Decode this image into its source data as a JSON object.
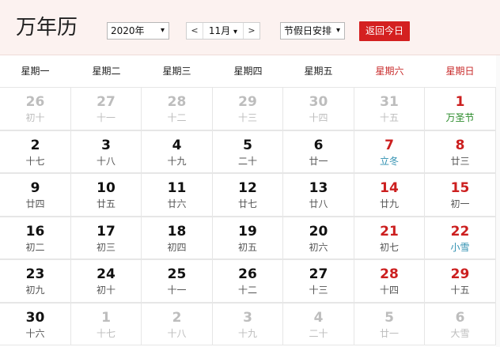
{
  "header": {
    "title": "万年历",
    "year_select": "2020年",
    "month_value": "11月",
    "prev": "<",
    "next": ">",
    "holiday_select": "节假日安排",
    "today_button": "返回今日",
    "arrow": "▾"
  },
  "weekdays": [
    "星期一",
    "星期二",
    "星期三",
    "星期四",
    "星期五",
    "星期六",
    "星期日"
  ],
  "weeks": [
    [
      {
        "day": "26",
        "lunar": "初十",
        "other": true
      },
      {
        "day": "27",
        "lunar": "十一",
        "other": true
      },
      {
        "day": "28",
        "lunar": "十二",
        "other": true
      },
      {
        "day": "29",
        "lunar": "十三",
        "other": true
      },
      {
        "day": "30",
        "lunar": "十四",
        "other": true
      },
      {
        "day": "31",
        "lunar": "十五",
        "other": true
      },
      {
        "day": "1",
        "lunar": "万圣节",
        "kind": "festival"
      }
    ],
    [
      {
        "day": "2",
        "lunar": "十七"
      },
      {
        "day": "3",
        "lunar": "十八"
      },
      {
        "day": "4",
        "lunar": "十九"
      },
      {
        "day": "5",
        "lunar": "二十"
      },
      {
        "day": "6",
        "lunar": "廿一"
      },
      {
        "day": "7",
        "lunar": "立冬",
        "kind": "term"
      },
      {
        "day": "8",
        "lunar": "廿三"
      }
    ],
    [
      {
        "day": "9",
        "lunar": "廿四"
      },
      {
        "day": "10",
        "lunar": "廿五"
      },
      {
        "day": "11",
        "lunar": "廿六"
      },
      {
        "day": "12",
        "lunar": "廿七"
      },
      {
        "day": "13",
        "lunar": "廿八"
      },
      {
        "day": "14",
        "lunar": "廿九"
      },
      {
        "day": "15",
        "lunar": "初一"
      }
    ],
    [
      {
        "day": "16",
        "lunar": "初二"
      },
      {
        "day": "17",
        "lunar": "初三"
      },
      {
        "day": "18",
        "lunar": "初四"
      },
      {
        "day": "19",
        "lunar": "初五"
      },
      {
        "day": "20",
        "lunar": "初六"
      },
      {
        "day": "21",
        "lunar": "初七"
      },
      {
        "day": "22",
        "lunar": "小雪",
        "kind": "term"
      }
    ],
    [
      {
        "day": "23",
        "lunar": "初九"
      },
      {
        "day": "24",
        "lunar": "初十"
      },
      {
        "day": "25",
        "lunar": "十一"
      },
      {
        "day": "26",
        "lunar": "十二"
      },
      {
        "day": "27",
        "lunar": "十三"
      },
      {
        "day": "28",
        "lunar": "十四"
      },
      {
        "day": "29",
        "lunar": "十五"
      }
    ],
    [
      {
        "day": "30",
        "lunar": "十六"
      },
      {
        "day": "1",
        "lunar": "十七",
        "other": true
      },
      {
        "day": "2",
        "lunar": "十八",
        "other": true
      },
      {
        "day": "3",
        "lunar": "十九",
        "other": true
      },
      {
        "day": "4",
        "lunar": "二十",
        "other": true
      },
      {
        "day": "5",
        "lunar": "廿一",
        "other": true
      },
      {
        "day": "6",
        "lunar": "大雪",
        "other": true
      }
    ]
  ],
  "colors": {
    "accent_red": "#d42020",
    "weekend_red": "#cc1f1f",
    "solar_term_blue": "#2e8fb0",
    "festival_green": "#2a8a2a",
    "other_month_gray": "#bdbdbd",
    "header_bg": "#fcf2f0"
  }
}
